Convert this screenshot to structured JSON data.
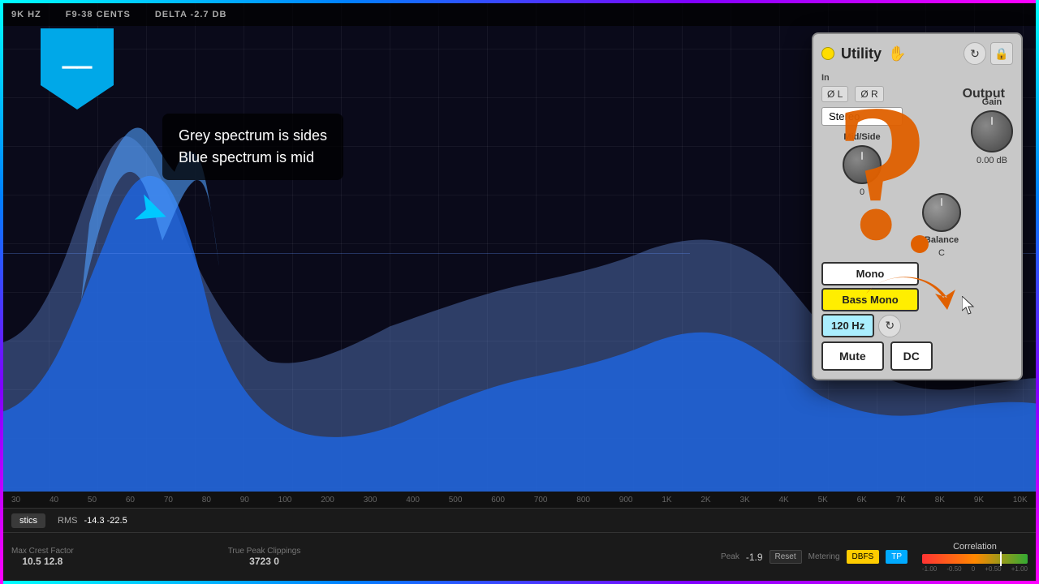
{
  "rainbow": {
    "exists": true
  },
  "topbar": {
    "hz_label": "9K HZ",
    "note_label": "F9-38 CENTS",
    "delta_label": "DELTA -2.7 DB"
  },
  "callout": {
    "line1": "Grey spectrum is sides",
    "line2": "Blue spectrum is mid"
  },
  "utility_panel": {
    "title": "Utility",
    "hand_icon": "✋",
    "output_label": "Output",
    "gain_label": "Gain",
    "gain_value": "0.00 dB",
    "mid_side_label": "Mid/Side",
    "mid_value": "0",
    "balance_label": "Balance",
    "balance_value": "C",
    "channel_mode": "Stereo",
    "mono_label": "Mono",
    "bass_mono_label": "Bass Mono",
    "hz_label": "120 Hz",
    "mute_label": "Mute",
    "dc_label": "DC"
  },
  "freq_labels": [
    "30",
    "40",
    "50",
    "60",
    "70",
    "80",
    "90",
    "100",
    "200",
    "300",
    "400",
    "500",
    "600",
    "700",
    "800",
    "900",
    "1K",
    "2K",
    "3K",
    "4K",
    "5K",
    "6K",
    "7K",
    "8K",
    "9K",
    "10K"
  ],
  "status_bar": {
    "tab_label": "stics",
    "rms_label": "RMS",
    "rms_value": "-14.3  -22.5",
    "max_crest_label": "Max Crest Factor",
    "max_crest_value": "10.5   12.8",
    "true_peak_label": "True Peak Clippings",
    "true_peak_value": "3723   0",
    "peak_label": "Peak",
    "peak_value": "-1.9",
    "reset_btn": "Reset",
    "metering_label": "Metering",
    "dbfs_btn": "DBFS",
    "tp_btn": "TP",
    "correlation_label": "Correlation"
  },
  "correlation": {
    "scale_values": [
      "-1.00",
      "-0.50",
      "0",
      "+0.50",
      "+1.00"
    ]
  }
}
